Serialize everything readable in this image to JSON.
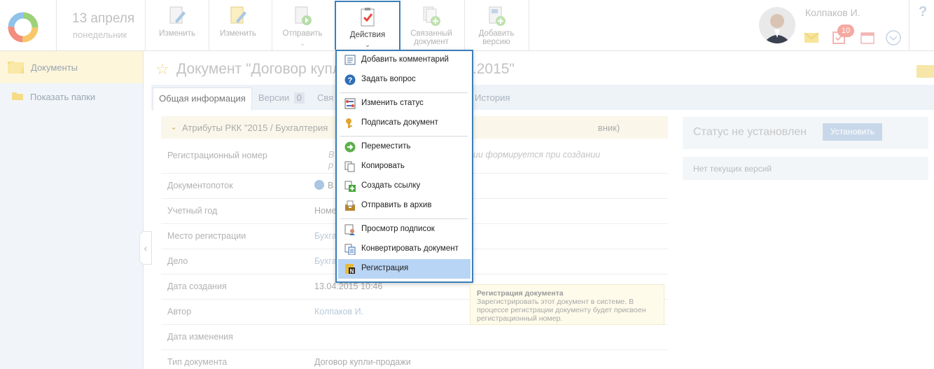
{
  "date": {
    "day": "13 апреля",
    "weekday": "понедельник"
  },
  "toolbar": {
    "edit1": "Изменить",
    "edit2": "Изменить",
    "send": "Отправить",
    "actions": "Действия",
    "related_line1": "Связанный",
    "related_line2": "документ",
    "add_line1": "Добавить",
    "add_line2": "версию"
  },
  "user": {
    "name": "Колпаков И.",
    "task_badge": "10"
  },
  "sidebar": {
    "documents": "Документы",
    "show_folders": "Показать папки"
  },
  "document": {
    "title": "Документ \"Договор купли-продажи от 13.04.2015\""
  },
  "tabs": {
    "general": "Общая информация",
    "versions": "Версии",
    "versions_count": "0",
    "related": "Свя",
    "history": "История"
  },
  "attributes": {
    "header": "Атрибуты РКК \"2015 / Бухгалтерия",
    "header_tail": "вник)",
    "rows": [
      {
        "label": "Регистрационный номер",
        "value": "В",
        "value2": "р",
        "note": "ии формируется при создании"
      },
      {
        "label": "Документопоток",
        "value": "В"
      },
      {
        "label": "Учетный год",
        "value": "Номе"
      },
      {
        "label": "Место регистрации",
        "value": "Бухга"
      },
      {
        "label": "Дело",
        "value": "Бухга"
      },
      {
        "label": "Дата создания",
        "value": "13.04.2015 10:46"
      },
      {
        "label": "Автор",
        "value": "Колпаков И."
      },
      {
        "label": "Дата изменения",
        "value": ""
      },
      {
        "label": "Тип документа",
        "value": "Договор купли-продажи"
      }
    ]
  },
  "status": {
    "text": "Статус не установлен",
    "button": "Установить",
    "no_versions": "Нет текущих версий"
  },
  "menu": {
    "items": [
      {
        "label": "Добавить комментарий",
        "icon": "comment-icon"
      },
      {
        "label": "Задать вопрос",
        "icon": "question-icon"
      },
      {
        "label": "Изменить статус",
        "icon": "status-icon"
      },
      {
        "label": "Подписать документ",
        "icon": "key-icon"
      },
      {
        "label": "Переместить",
        "icon": "move-icon"
      },
      {
        "label": "Копировать",
        "icon": "copy-icon"
      },
      {
        "label": "Создать ссылку",
        "icon": "link-icon"
      },
      {
        "label": "Отправить в архив",
        "icon": "archive-icon"
      },
      {
        "label": "Просмотр подписок",
        "icon": "subscriptions-icon"
      },
      {
        "label": "Конвертировать документ",
        "icon": "convert-icon"
      },
      {
        "label": "Регистрация",
        "icon": "register-icon"
      }
    ]
  },
  "tooltip": {
    "title": "Регистрация документа",
    "text": "Зарегистрировать этот документ в системе. В процессе регистрации документу будет присвоен регистрационный номер."
  },
  "colors": {
    "accent": "#3b7fb8",
    "highlight": "#b9d5f5",
    "sidebar_active": "#fdf6db"
  }
}
